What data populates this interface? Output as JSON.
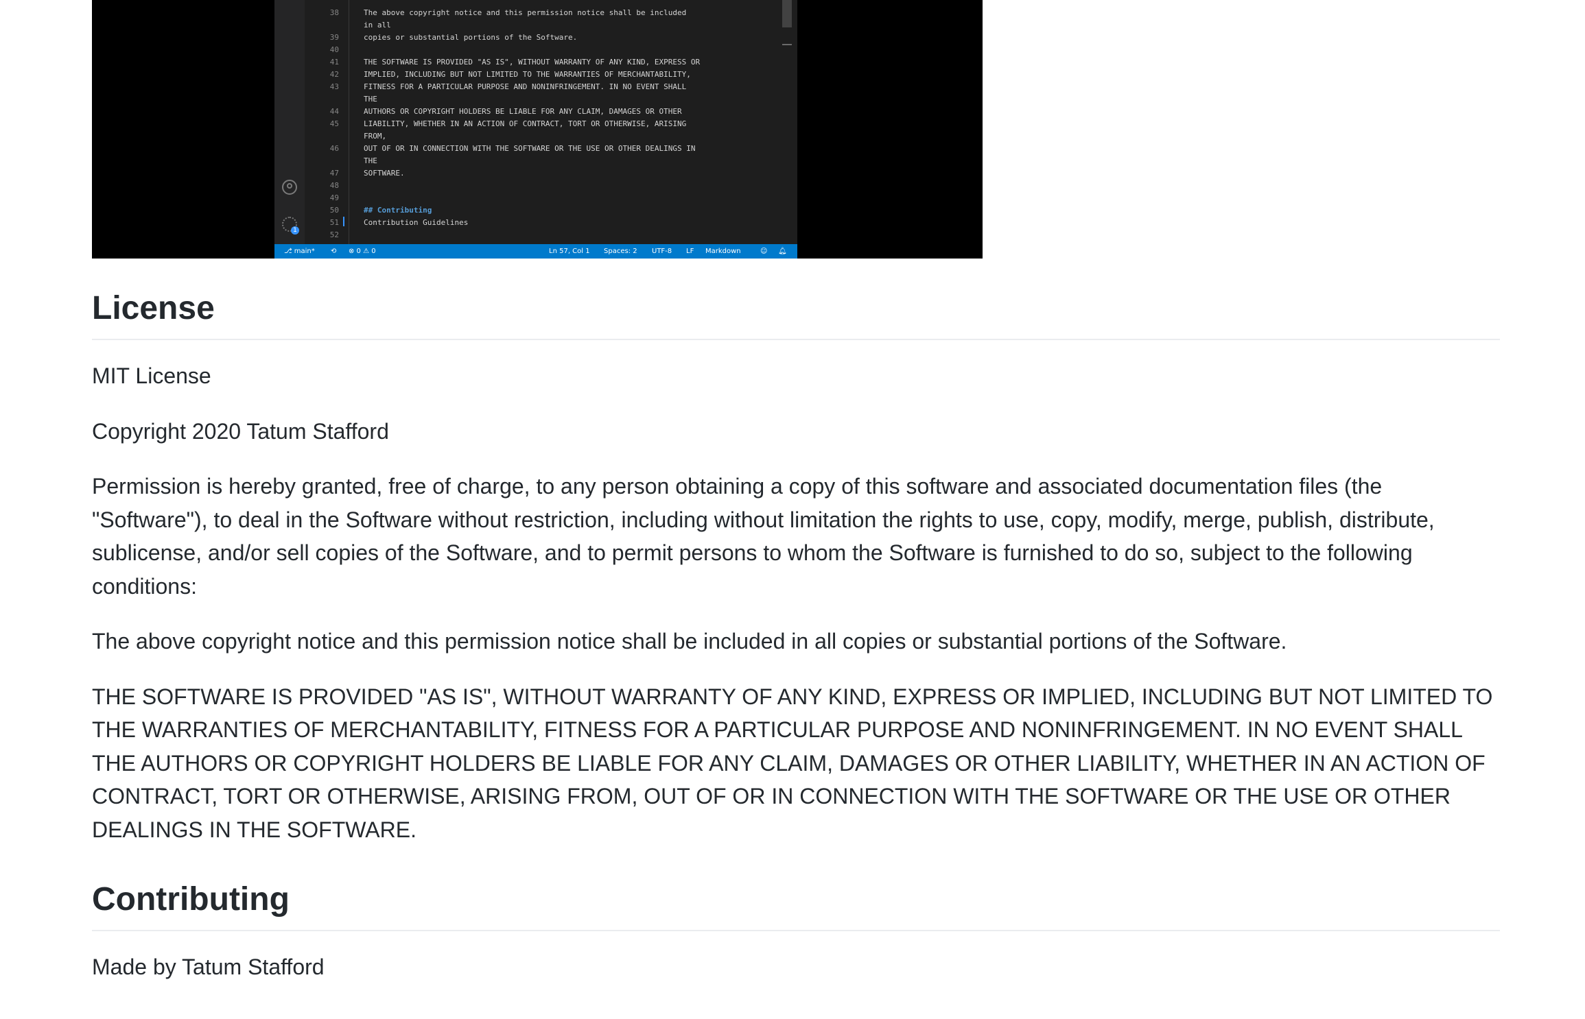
{
  "editor": {
    "lines": [
      {
        "num": "38",
        "text": "The above copyright notice and this permission notice shall be included"
      },
      {
        "num": "",
        "text": "in all"
      },
      {
        "num": "39",
        "text": "copies or substantial portions of the Software."
      },
      {
        "num": "40",
        "text": ""
      },
      {
        "num": "41",
        "text": "THE SOFTWARE IS PROVIDED \"AS IS\", WITHOUT WARRANTY OF ANY KIND, EXPRESS OR"
      },
      {
        "num": "42",
        "text": "IMPLIED, INCLUDING BUT NOT LIMITED TO THE WARRANTIES OF MERCHANTABILITY,"
      },
      {
        "num": "43",
        "text": "FITNESS FOR A PARTICULAR PURPOSE AND NONINFRINGEMENT. IN NO EVENT SHALL"
      },
      {
        "num": "",
        "text": "THE"
      },
      {
        "num": "44",
        "text": "AUTHORS OR COPYRIGHT HOLDERS BE LIABLE FOR ANY CLAIM, DAMAGES OR OTHER"
      },
      {
        "num": "45",
        "text": "LIABILITY, WHETHER IN AN ACTION OF CONTRACT, TORT OR OTHERWISE, ARISING"
      },
      {
        "num": "",
        "text": "FROM,"
      },
      {
        "num": "46",
        "text": "OUT OF OR IN CONNECTION WITH THE SOFTWARE OR THE USE OR OTHER DEALINGS IN"
      },
      {
        "num": "",
        "text": "THE"
      },
      {
        "num": "47",
        "text": "SOFTWARE."
      },
      {
        "num": "48",
        "text": ""
      },
      {
        "num": "49",
        "text": ""
      },
      {
        "num": "50",
        "text": "## Contributing",
        "style": "heading"
      },
      {
        "num": "51",
        "text": "Contribution Guidelines"
      },
      {
        "num": "52",
        "text": ""
      }
    ],
    "gear_badge": "1",
    "status": {
      "branch": "main*",
      "problems": "⊗ 0 ⚠ 0",
      "position": "Ln 57, Col 1",
      "spaces": "Spaces: 2",
      "encoding": "UTF-8",
      "eol": "LF",
      "language": "Markdown"
    },
    "colors": {
      "statusbar": "#007acc",
      "editor_bg": "#1e1e1e",
      "heading": "#569cd6"
    }
  },
  "license": {
    "heading": "License",
    "name": "MIT License",
    "copyright": "Copyright 2020 Tatum Stafford",
    "permission": "Permission is hereby granted, free of charge, to any person obtaining a copy of this software and associated documentation files (the \"Software\"), to deal in the Software without restriction, including without limitation the rights to use, copy, modify, merge, publish, distribute, sublicense, and/or sell copies of the Software, and to permit persons to whom the Software is furnished to do so, subject to the following conditions:",
    "notice": "The above copyright notice and this permission notice shall be included in all copies or substantial portions of the Software.",
    "warranty": "THE SOFTWARE IS PROVIDED \"AS IS\", WITHOUT WARRANTY OF ANY KIND, EXPRESS OR IMPLIED, INCLUDING BUT NOT LIMITED TO THE WARRANTIES OF MERCHANTABILITY, FITNESS FOR A PARTICULAR PURPOSE AND NONINFRINGEMENT. IN NO EVENT SHALL THE AUTHORS OR COPYRIGHT HOLDERS BE LIABLE FOR ANY CLAIM, DAMAGES OR OTHER LIABILITY, WHETHER IN AN ACTION OF CONTRACT, TORT OR OTHERWISE, ARISING FROM, OUT OF OR IN CONNECTION WITH THE SOFTWARE OR THE USE OR OTHER DEALINGS IN THE SOFTWARE."
  },
  "contributing": {
    "heading": "Contributing",
    "text": "Made by Tatum Stafford"
  }
}
